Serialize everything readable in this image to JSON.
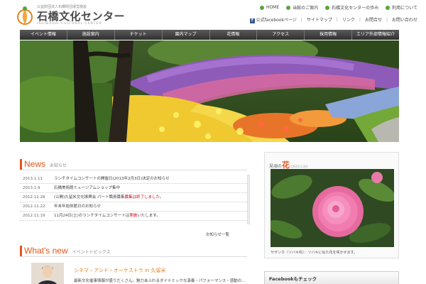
{
  "header": {
    "logo_small": "公益財団法人石橋財団運営施設",
    "logo_main": "石橋文化センター",
    "logo_en": "ISHIBASHI CULTURAL CENTER",
    "util_nav": [
      "HOME",
      "当館のご案内",
      "石橋文化センターの歩み",
      "利用について"
    ],
    "sub_nav": [
      "公式facebookページ",
      "｜",
      "サイトマップ",
      "｜",
      "リンク",
      "｜",
      "お問合せ",
      "｜",
      "お問い合わせ"
    ]
  },
  "main_nav": [
    "イベント情報",
    "施設案内",
    "チケット",
    "園内マップ",
    "花情報",
    "アクセス",
    "採用情報",
    "エリア外部情報紹介"
  ],
  "news": {
    "title_en": "News",
    "title_jp": "お知らせ",
    "items": [
      {
        "date": "2013.1.11",
        "text": "ランチタイムコンサートの開催日(2013年2月3日)決定のお知らせ",
        "highlight": ""
      },
      {
        "date": "2013.1.9",
        "text": "石橋美術館ミュージアムショップ集中",
        "highlight": ""
      },
      {
        "date": "2012.12.28",
        "text": "(公開)久留米文化振興会 パート職員募集",
        "highlight": "募集は終了しました。"
      },
      {
        "date": "2012.11.22",
        "text": "年末年始休館日のお知らせ",
        "highlight": ""
      },
      {
        "date": "2012.11.19",
        "text": "11月24日(土)のランチタイムコンサートは",
        "highlight": "実施",
        "suffix": "いたします。"
      }
    ],
    "more": "お知らせ一覧"
  },
  "whatsnew": {
    "title_en": "What's new",
    "title_jp": "イベントトピックス",
    "headline": "シネマ・アンド・オーケストラ in 久留米",
    "body": "最新文化催事情報が盛りだくさん。魅力あふれるダイナミックな演奏・パフォーマンス・感動の..."
  },
  "side": {
    "title_prefix": "見頃の",
    "title_hana": "花",
    "title_small": "(2013.1.10)",
    "caption": "サザンカ（ツバキ科）：ツバキに似た花を咲かせます。"
  },
  "facebook": {
    "label": "Facebookもチェック"
  },
  "colors": {
    "accent": "#e6551a",
    "nav_bg": "#3a3a3a",
    "util_dot": "#5aa43c",
    "highlight_red": "#d0021b"
  }
}
